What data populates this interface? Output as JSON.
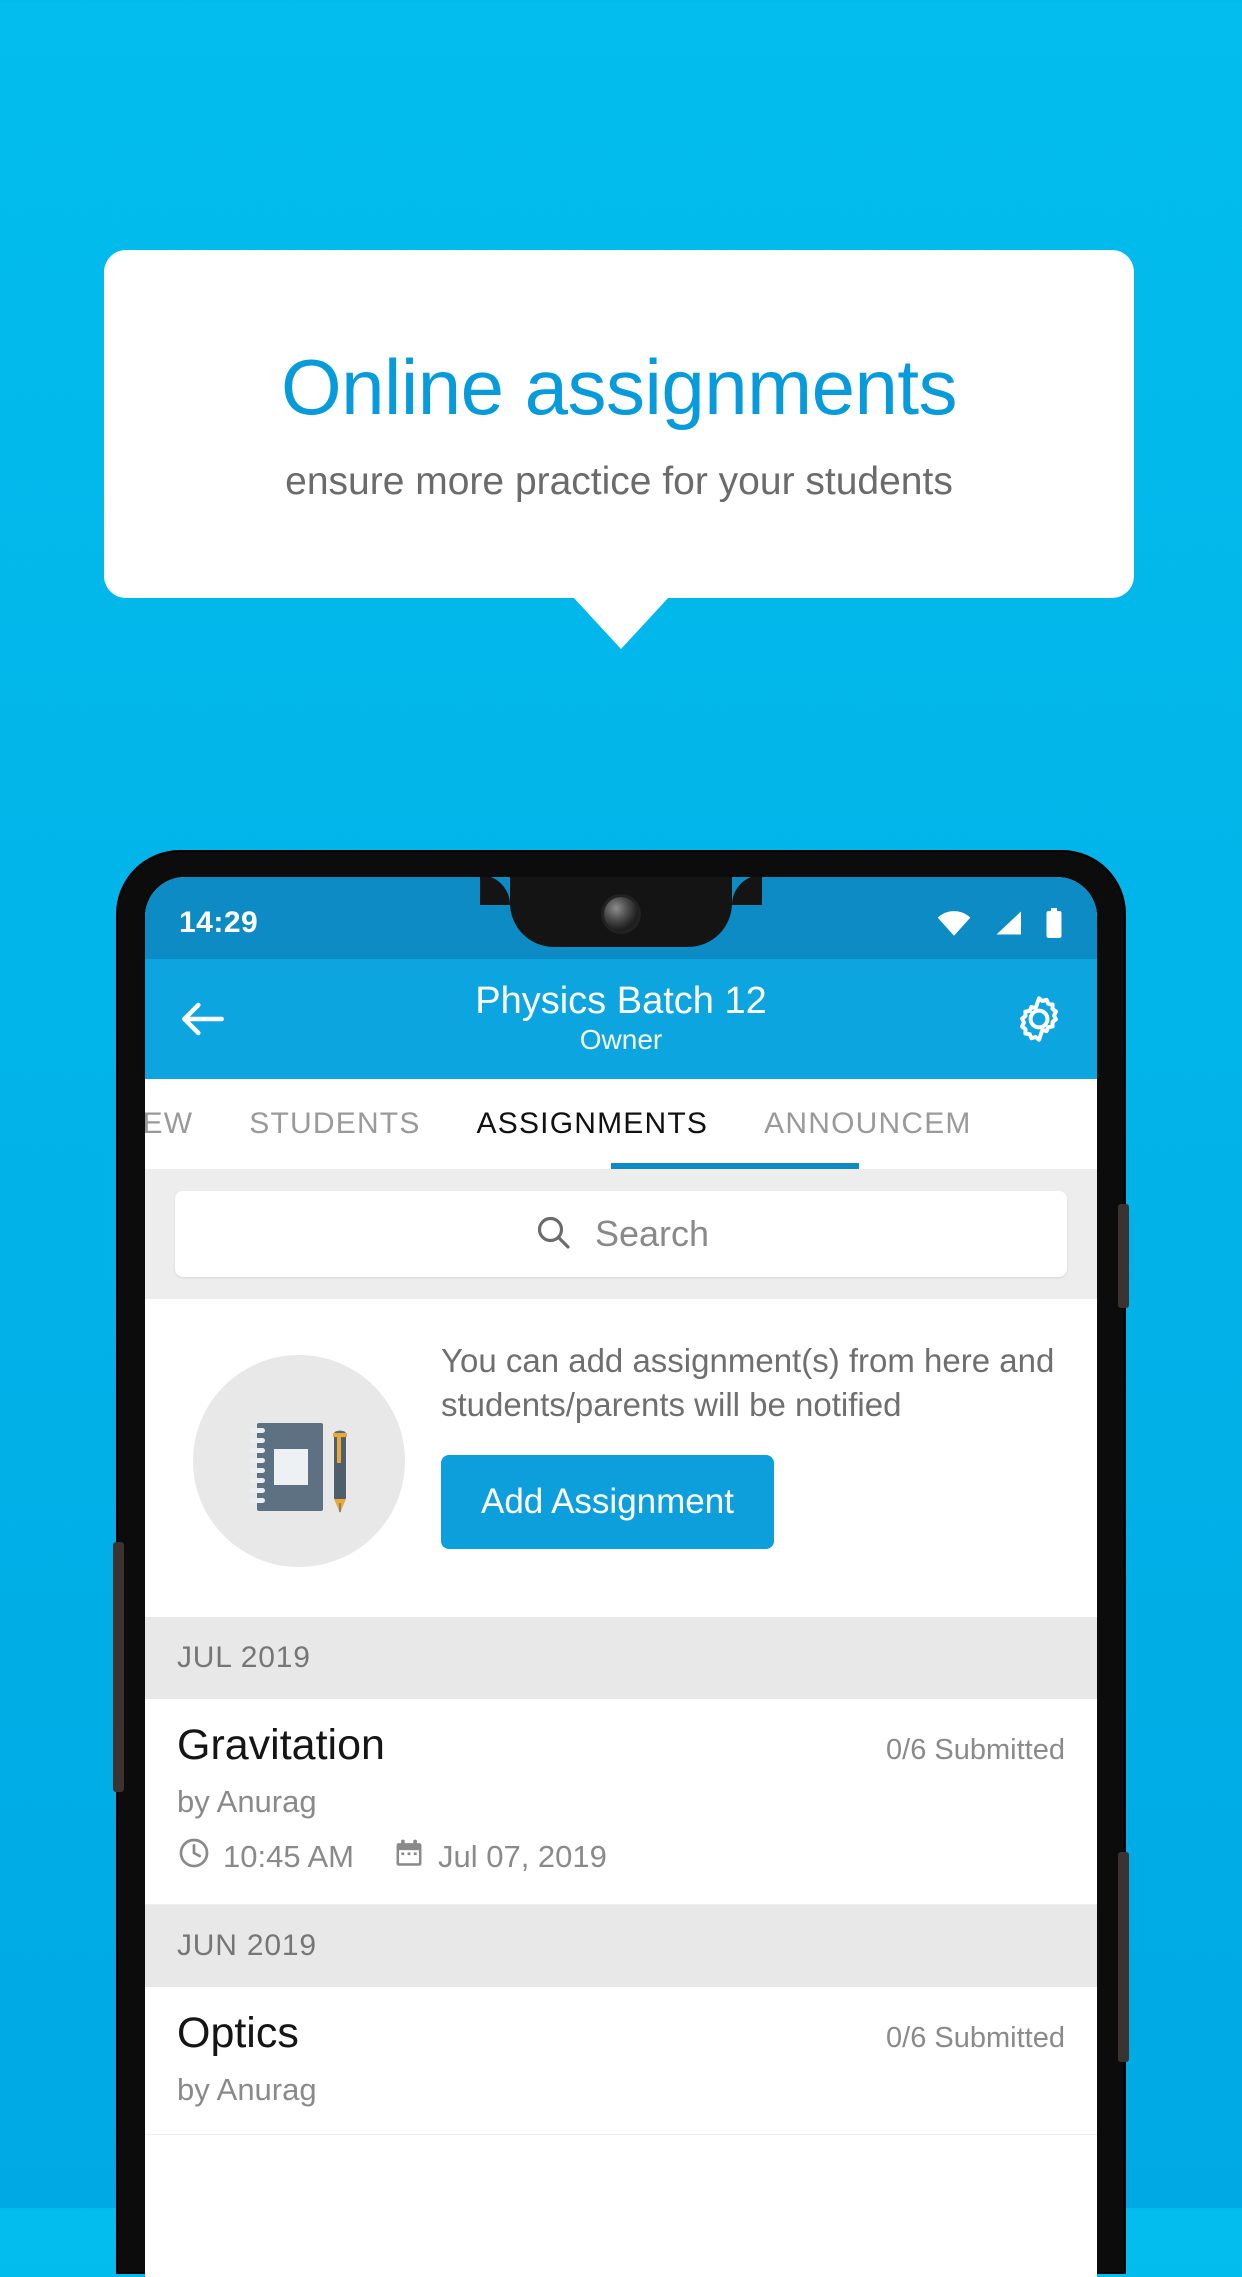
{
  "promo": {
    "title": "Online assignments",
    "subtitle": "ensure more practice for your students",
    "title_color": "#089BDC",
    "subtitle_color": "#6B6B6B",
    "background_color": "#00BCEE"
  },
  "phone": {
    "status_bar": {
      "time": "14:29",
      "icons": [
        "wifi-icon",
        "signal-icon",
        "battery-icon"
      ],
      "background_color": "#0D8BC4"
    },
    "app_bar": {
      "back_icon": "back-arrow-icon",
      "title": "Physics Batch 12",
      "subtitle": "Owner",
      "settings_icon": "gear-icon",
      "background_color": "#0DA5E0"
    },
    "tabs": {
      "items": [
        {
          "label": "IEW",
          "active": false
        },
        {
          "label": "STUDENTS",
          "active": false
        },
        {
          "label": "ASSIGNMENTS",
          "active": true
        },
        {
          "label": "ANNOUNCEM",
          "active": false
        }
      ],
      "indicator_color": "#0D8BC4"
    },
    "search": {
      "icon": "search-icon",
      "placeholder": "Search",
      "value": ""
    },
    "empty_state": {
      "illustration": "notebook-and-pen-icon",
      "message": "You can add assignment(s) from here and students/parents will be notified",
      "button_label": "Add Assignment",
      "button_color": "#0D9FDC"
    },
    "groups": [
      {
        "month": "JUL 2019",
        "assignments": [
          {
            "title": "Gravitation",
            "status": "0/6 Submitted",
            "author": "by Anurag",
            "time_icon": "clock-icon",
            "time": "10:45 AM",
            "date_icon": "calendar-icon",
            "date": "Jul 07, 2019"
          }
        ]
      },
      {
        "month": "JUN 2019",
        "assignments": [
          {
            "title": "Optics",
            "status": "0/6 Submitted",
            "author": "by Anurag",
            "time_icon": "clock-icon",
            "time": "",
            "date_icon": "calendar-icon",
            "date": ""
          }
        ]
      }
    ]
  }
}
